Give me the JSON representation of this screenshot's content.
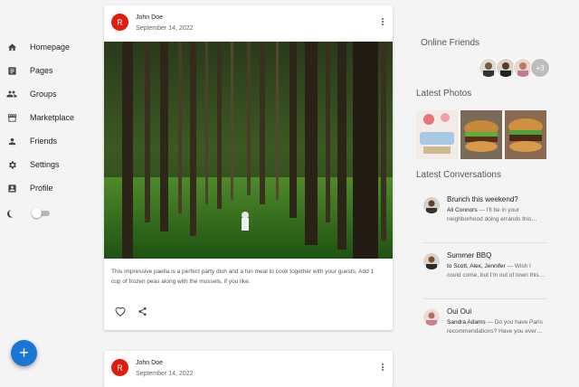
{
  "sidebar": {
    "items": [
      {
        "label": "Homepage",
        "icon": "home-icon"
      },
      {
        "label": "Pages",
        "icon": "article-icon"
      },
      {
        "label": "Groups",
        "icon": "group-icon"
      },
      {
        "label": "Marketplace",
        "icon": "storefront-icon"
      },
      {
        "label": "Friends",
        "icon": "person-icon"
      },
      {
        "label": "Settings",
        "icon": "gear-icon"
      },
      {
        "label": "Profile",
        "icon": "account-box-icon"
      }
    ],
    "dark_mode": false
  },
  "fab": {
    "label": "+",
    "color": "#1976d2"
  },
  "posts": [
    {
      "avatar": "R",
      "author": "John Doe",
      "date": "September 14, 2022",
      "text": "This impressive paella is a perfect party dish and a fun meal to cook together with your guests. Add 1 cup of frozen peas along with the mussels, if you like.",
      "image": "forest-photo"
    },
    {
      "avatar": "R",
      "author": "John Doe",
      "date": "September 14, 2022"
    }
  ],
  "right": {
    "online_title": "Online Friends",
    "online_more": "+3",
    "photos_title": "Latest Photos",
    "conversations_title": "Latest Conversations",
    "conversations": [
      {
        "title": "Brunch this weekend?",
        "from": "Ali Connors",
        "text": " — I'll be in your neighborhood doing errands this…"
      },
      {
        "title": "Summer BBQ",
        "from": "to Scott, Alex, Jennifer",
        "text": " — Wish I could come, but I'm out of town this…"
      },
      {
        "title": "Oui Oui",
        "from": "Sandra Adams",
        "text": " — Do you have Paris recommendations? Have you ever…"
      }
    ]
  },
  "colors": {
    "accent": "#1976d2",
    "avatar": "#e31b0c"
  }
}
